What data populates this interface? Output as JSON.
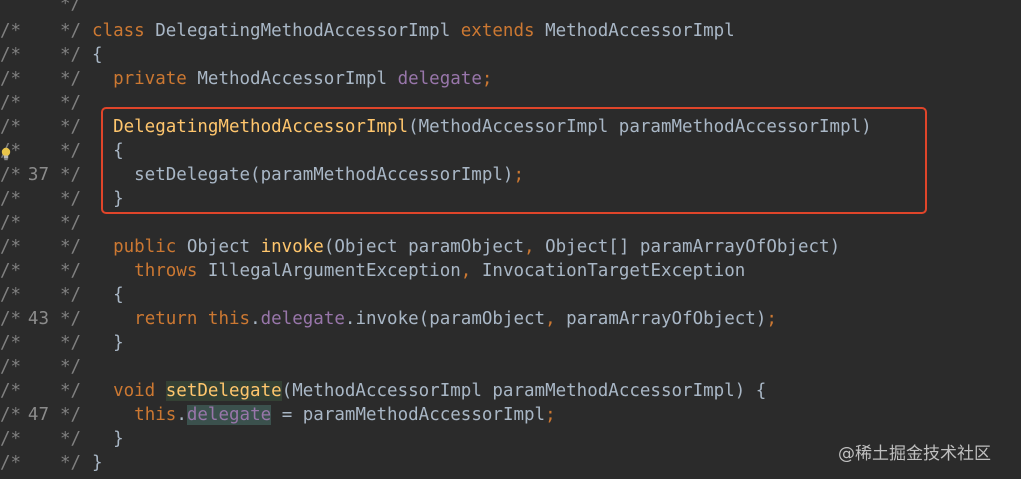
{
  "editor": {
    "lines": [
      {
        "pre": "",
        "num": "",
        "post": "*/",
        "code": []
      },
      {
        "pre": "/*",
        "num": "",
        "post": "*/",
        "code": [
          [
            "kw",
            "class "
          ],
          [
            "plain",
            "DelegatingMethodAccessorImpl "
          ],
          [
            "kw",
            "extends "
          ],
          [
            "plain",
            "MethodAccessorImpl"
          ]
        ]
      },
      {
        "pre": "/*",
        "num": "",
        "post": "*/",
        "code": [
          [
            "plain",
            "{"
          ]
        ]
      },
      {
        "pre": "/*",
        "num": "",
        "post": "*/",
        "code": [
          [
            "plain",
            "  "
          ],
          [
            "kw",
            "private "
          ],
          [
            "plain",
            "MethodAccessorImpl "
          ],
          [
            "fld",
            "delegate"
          ],
          [
            "kw",
            ";"
          ]
        ]
      },
      {
        "pre": "/*",
        "num": "",
        "post": "*/",
        "code": []
      },
      {
        "pre": "/*",
        "num": "",
        "post": "*/",
        "code": [
          [
            "plain",
            "  "
          ],
          [
            "fn",
            "DelegatingMethodAccessorImpl"
          ],
          [
            "plain",
            "(MethodAccessorImpl paramMethodAccessorImpl)"
          ]
        ]
      },
      {
        "pre": "/*",
        "num": "",
        "post": "*/",
        "code": [
          [
            "plain",
            "  {"
          ]
        ]
      },
      {
        "pre": "/*",
        "num": "37",
        "post": "*/",
        "code": [
          [
            "plain",
            "    setDelegate(paramMethodAccessorImpl)"
          ],
          [
            "kw",
            ";"
          ]
        ]
      },
      {
        "pre": "/*",
        "num": "",
        "post": "*/",
        "code": [
          [
            "plain",
            "  }"
          ]
        ]
      },
      {
        "pre": "/*",
        "num": "",
        "post": "*/",
        "code": []
      },
      {
        "pre": "/*",
        "num": "",
        "post": "*/",
        "code": [
          [
            "plain",
            "  "
          ],
          [
            "kw",
            "public "
          ],
          [
            "plain",
            "Object "
          ],
          [
            "fn",
            "invoke"
          ],
          [
            "plain",
            "(Object paramObject"
          ],
          [
            "kw",
            ", "
          ],
          [
            "plain",
            "Object[] paramArrayOfObject)"
          ]
        ]
      },
      {
        "pre": "/*",
        "num": "",
        "post": "*/",
        "code": [
          [
            "plain",
            "    "
          ],
          [
            "kw",
            "throws "
          ],
          [
            "plain",
            "IllegalArgumentException"
          ],
          [
            "kw",
            ", "
          ],
          [
            "plain",
            "InvocationTargetException"
          ]
        ]
      },
      {
        "pre": "/*",
        "num": "",
        "post": "*/",
        "code": [
          [
            "plain",
            "  {"
          ]
        ]
      },
      {
        "pre": "/*",
        "num": "43",
        "post": "*/",
        "code": [
          [
            "plain",
            "    "
          ],
          [
            "kw",
            "return this"
          ],
          [
            "plain",
            "."
          ],
          [
            "fld",
            "delegate"
          ],
          [
            "plain",
            ".invoke(paramObject"
          ],
          [
            "kw",
            ", "
          ],
          [
            "plain",
            "paramArrayOfObject)"
          ],
          [
            "kw",
            ";"
          ]
        ]
      },
      {
        "pre": "/*",
        "num": "",
        "post": "*/",
        "code": [
          [
            "plain",
            "  }"
          ]
        ]
      },
      {
        "pre": "/*",
        "num": "",
        "post": "*/",
        "code": []
      },
      {
        "pre": "/*",
        "num": "",
        "post": "*/",
        "code": [
          [
            "plain",
            "  "
          ],
          [
            "kw",
            "void "
          ],
          [
            "fnhl",
            "setDelegate"
          ],
          [
            "plain",
            "(MethodAccessorImpl paramMethodAccessorImpl) {"
          ]
        ]
      },
      {
        "pre": "/*",
        "num": "47",
        "post": "*/",
        "code": [
          [
            "plain",
            "    "
          ],
          [
            "kw",
            "this"
          ],
          [
            "plain",
            "."
          ],
          [
            "fldhl",
            "delegate"
          ],
          [
            "plain",
            " = paramMethodAccessorImpl"
          ],
          [
            "kw",
            ";"
          ]
        ]
      },
      {
        "pre": "/*",
        "num": "",
        "post": "*/",
        "code": [
          [
            "plain",
            "  }"
          ]
        ]
      },
      {
        "pre": "/*",
        "num": "",
        "post": "*/",
        "code": [
          [
            "plain",
            "}"
          ]
        ]
      }
    ],
    "line_tops": [
      -8,
      19,
      43,
      67,
      91,
      115,
      139,
      163,
      187,
      211,
      235,
      259,
      283,
      307,
      331,
      355,
      379,
      403,
      427,
      451
    ],
    "code_offsets": [
      92,
      92,
      92,
      92,
      92,
      92,
      92,
      92,
      92,
      92,
      92,
      92,
      92,
      92,
      92,
      92,
      92,
      92,
      92,
      92
    ]
  },
  "colors": {
    "background": "#2b2b2b",
    "keyword": "#cc7832",
    "field": "#9876aa",
    "function": "#ffc66d",
    "plain": "#a9b7c6",
    "gutter": "#808080",
    "highlight_box": "#e0452a"
  },
  "icons": {
    "lightbulb": "lightbulb-icon"
  },
  "watermark": "@稀土掘金技术社区"
}
